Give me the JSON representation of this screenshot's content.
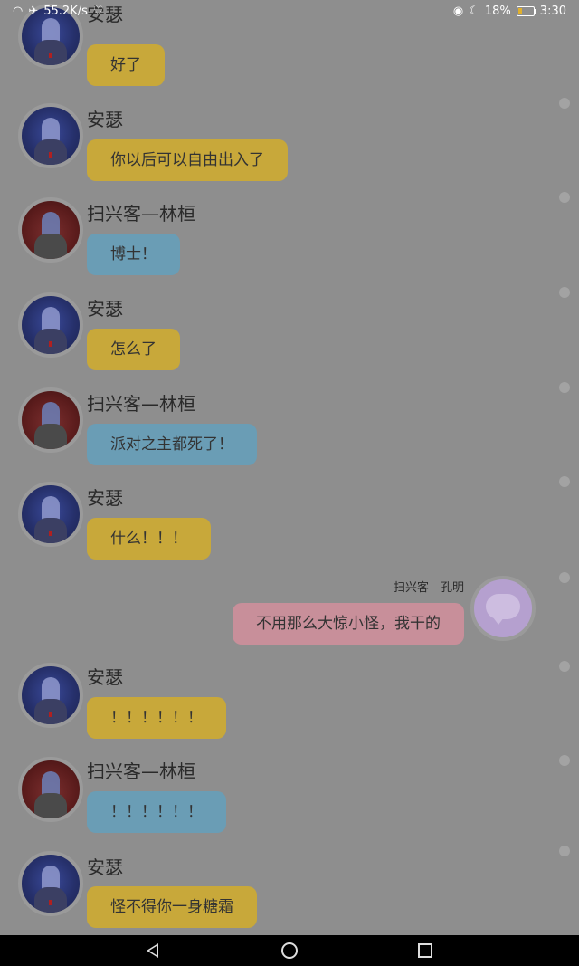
{
  "status_bar": {
    "network_speed": "55.2K/s",
    "battery": "18%",
    "time": "3:30",
    "icons": [
      "wifi-icon",
      "airplane-icon",
      "heart-icon",
      "eye-icon",
      "moon-icon",
      "battery-icon"
    ]
  },
  "messages": [
    {
      "name": "安瑟",
      "text": "好了",
      "avatar": "blue",
      "color": "gold"
    },
    {
      "name": "安瑟",
      "text": "你以后可以自由出入了",
      "avatar": "blue",
      "color": "gold"
    },
    {
      "name": "扫兴客—林桓",
      "text": "博士！",
      "avatar": "red",
      "color": "blue"
    },
    {
      "name": "安瑟",
      "text": "怎么了",
      "avatar": "blue",
      "color": "gold"
    },
    {
      "name": "扫兴客—林桓",
      "text": "派对之主都死了！",
      "avatar": "red",
      "color": "blue"
    },
    {
      "name": "安瑟",
      "text": "什么！！！",
      "avatar": "blue",
      "color": "gold"
    },
    {
      "name": "扫兴客—孔明",
      "text": "不用那么大惊小怪，我干的",
      "avatar": "chat",
      "color": "pink",
      "side": "right"
    },
    {
      "name": "安瑟",
      "text": "！！！！！！",
      "avatar": "blue",
      "color": "gold"
    },
    {
      "name": "扫兴客—林桓",
      "text": "！！！！！！",
      "avatar": "red",
      "color": "blue"
    },
    {
      "name": "安瑟",
      "text": "怪不得你一身糖霜",
      "avatar": "blue",
      "color": "gold"
    }
  ],
  "colors": {
    "overlay": "#8e8e8e",
    "gold_bubble": "#c8a83a",
    "blue_bubble": "#6a9db5",
    "pink_bubble": "#c88f9a"
  },
  "nav": {
    "icons": [
      "back-icon",
      "home-icon",
      "recents-icon"
    ]
  }
}
